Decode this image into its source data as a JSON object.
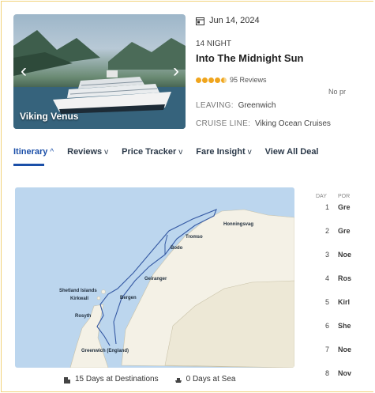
{
  "card": {
    "ship_name": "Viking Venus",
    "date": "Jun 14, 2024",
    "nights": "14 NIGHT",
    "title": "Into The Midnight Sun",
    "reviews": "95 Reviews",
    "rating": 4.5,
    "leaving_label": "LEAVING:",
    "leaving_value": "Greenwich",
    "line_label": "CRUISE LINE:",
    "line_value": "Viking Ocean Cruises",
    "no_price": "No pr",
    "prev_icon": "chevron-left-icon",
    "next_icon": "chevron-right-icon",
    "date_icon": "calendar-icon"
  },
  "tabs": [
    {
      "label": "Itinerary",
      "chevron": "^"
    },
    {
      "label": "Reviews",
      "chevron": "v"
    },
    {
      "label": "Price Tracker",
      "chevron": "v"
    },
    {
      "label": "Fare Insight",
      "chevron": "v"
    },
    {
      "label": "View All Deal",
      "chevron": ""
    }
  ],
  "map": {
    "ports": [
      "Honningsvag",
      "Tromso",
      "Bodo",
      "Geiranger",
      "Bergen",
      "Shetland Islands",
      "Kirkwall",
      "Rosyth",
      "Greenwich (England)"
    ]
  },
  "stats": {
    "destinations": "15 Days at Destinations",
    "sea": "0 Days at Sea"
  },
  "table": {
    "headers": [
      "DAY",
      "POR"
    ],
    "rows": [
      {
        "day": "1",
        "port": "Gre"
      },
      {
        "day": "2",
        "port": "Gre"
      },
      {
        "day": "3",
        "port": "Noe"
      },
      {
        "day": "4",
        "port": "Ros"
      },
      {
        "day": "5",
        "port": "Kirl"
      },
      {
        "day": "6",
        "port": "She"
      },
      {
        "day": "7",
        "port": "Noe"
      },
      {
        "day": "8",
        "port": "Nov"
      }
    ]
  },
  "colors": {
    "accent": "#1b4fa8",
    "star": "#f0a51d",
    "map_water": "#bcd6ee",
    "map_land": "#f4f1e6"
  }
}
